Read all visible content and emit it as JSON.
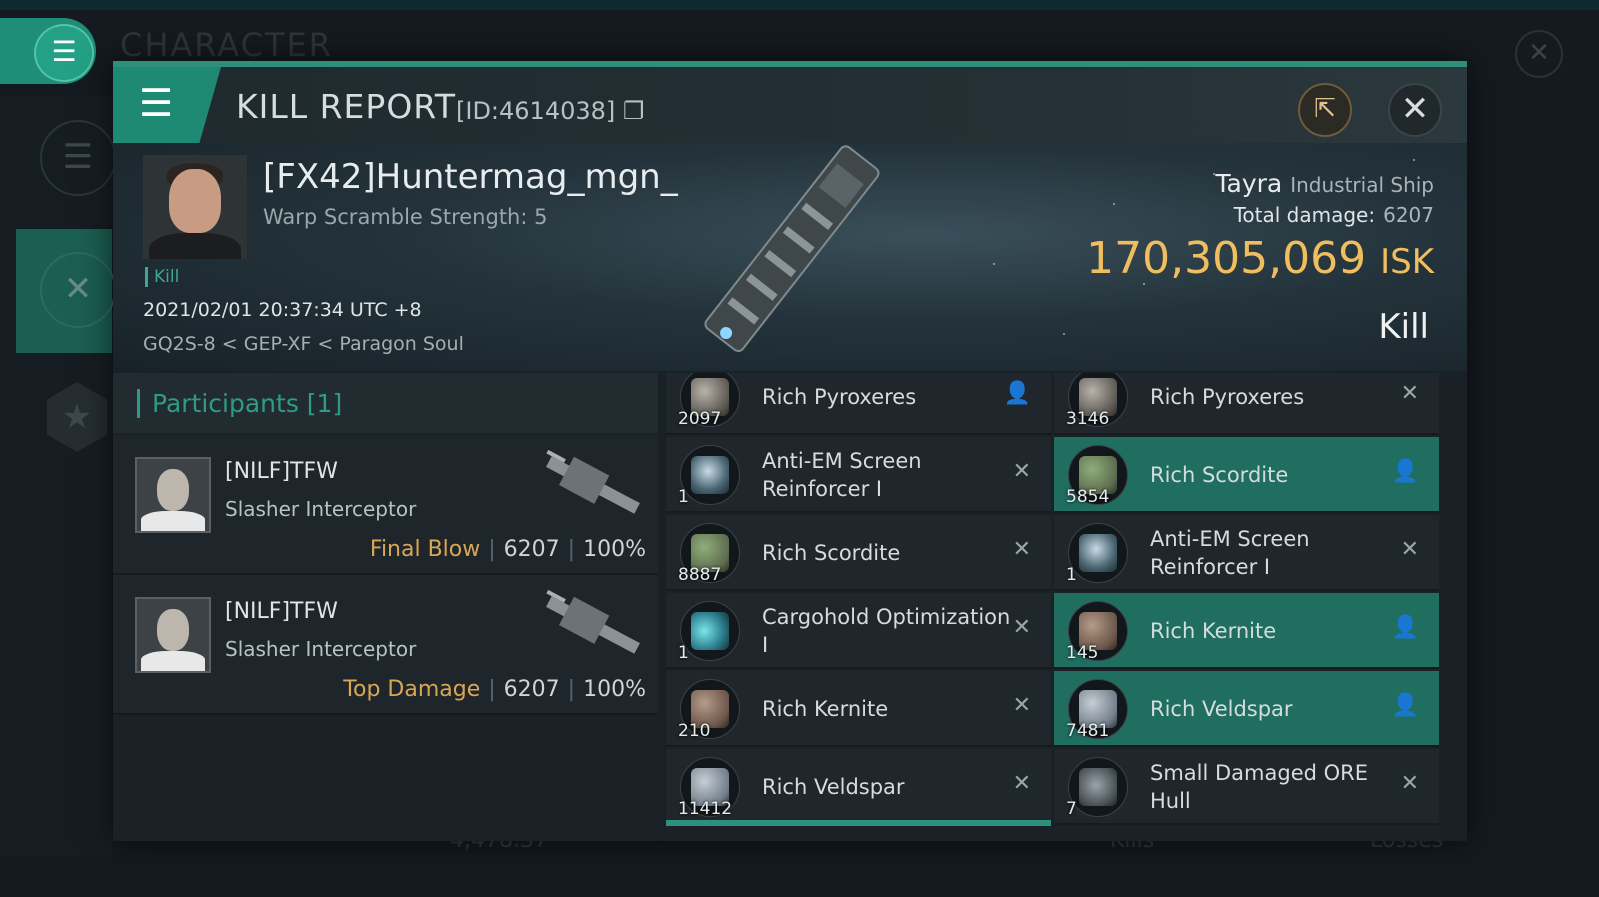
{
  "background": {
    "title": "CHARACTER",
    "bottom_text_left": "4,478.37",
    "bottom_text_kills": "Kills",
    "bottom_text_losses": "Losses"
  },
  "header": {
    "title": "KILL REPORT",
    "id": "[ID:4614038]"
  },
  "victim": {
    "name": "[FX42]Huntermag_mgn_",
    "warp_scramble": "Warp Scramble Strength: 5",
    "tag": "Kill",
    "datetime": "2021/02/01 20:37:34 UTC +8",
    "location": "GQ2S-8 < GEP-XF < Paragon Soul",
    "ship": "Tayra",
    "ship_class": "Industrial Ship",
    "total_damage_label": "Total damage:",
    "total_damage": "6207",
    "isk_value": "170,305,069",
    "isk_unit": "ISK",
    "result": "Kill"
  },
  "participants": {
    "header": "Participants [1]",
    "rows": [
      {
        "name": "[NILF]TFW",
        "ship": "Slasher Interceptor",
        "label": "Final Blow",
        "damage": "6207",
        "percent": "100%"
      },
      {
        "name": "[NILF]TFW",
        "ship": "Slasher Interceptor",
        "label": "Top Damage",
        "damage": "6207",
        "percent": "100%"
      }
    ]
  },
  "items": [
    {
      "name": "Rich Pyroxeres",
      "qty": "2097",
      "dropped": true,
      "icon": "pyroxeres-ore-icon"
    },
    {
      "name": "Rich Pyroxeres",
      "qty": "3146",
      "dropped": false,
      "icon": "pyroxeres-ore-icon"
    },
    {
      "name": "Anti-EM Screen Reinforcer I",
      "qty": "1",
      "dropped": false,
      "icon": "shield-rig-icon"
    },
    {
      "name": "Rich Scordite",
      "qty": "5854",
      "dropped": true,
      "icon": "scordite-ore-icon"
    },
    {
      "name": "Rich Scordite",
      "qty": "8887",
      "dropped": false,
      "icon": "scordite-ore-icon"
    },
    {
      "name": "Anti-EM Screen Reinforcer I",
      "qty": "1",
      "dropped": false,
      "icon": "shield-rig-icon"
    },
    {
      "name": "Cargohold Optimization I",
      "qty": "1",
      "dropped": false,
      "icon": "cargo-rig-icon"
    },
    {
      "name": "Rich Kernite",
      "qty": "145",
      "dropped": true,
      "icon": "kernite-ore-icon"
    },
    {
      "name": "Rich Kernite",
      "qty": "210",
      "dropped": false,
      "icon": "kernite-ore-icon"
    },
    {
      "name": "Rich Veldspar",
      "qty": "7481",
      "dropped": true,
      "icon": "veldspar-ore-icon"
    },
    {
      "name": "Rich Veldspar",
      "qty": "11412",
      "dropped": false,
      "icon": "veldspar-ore-icon"
    },
    {
      "name": "Small Damaged ORE Hull",
      "qty": "7",
      "dropped": false,
      "icon": "damaged-hull-icon"
    }
  ],
  "colors": {
    "accent": "#1e8a74",
    "isk": "#f0be5e",
    "final_blow": "#d9a654"
  }
}
